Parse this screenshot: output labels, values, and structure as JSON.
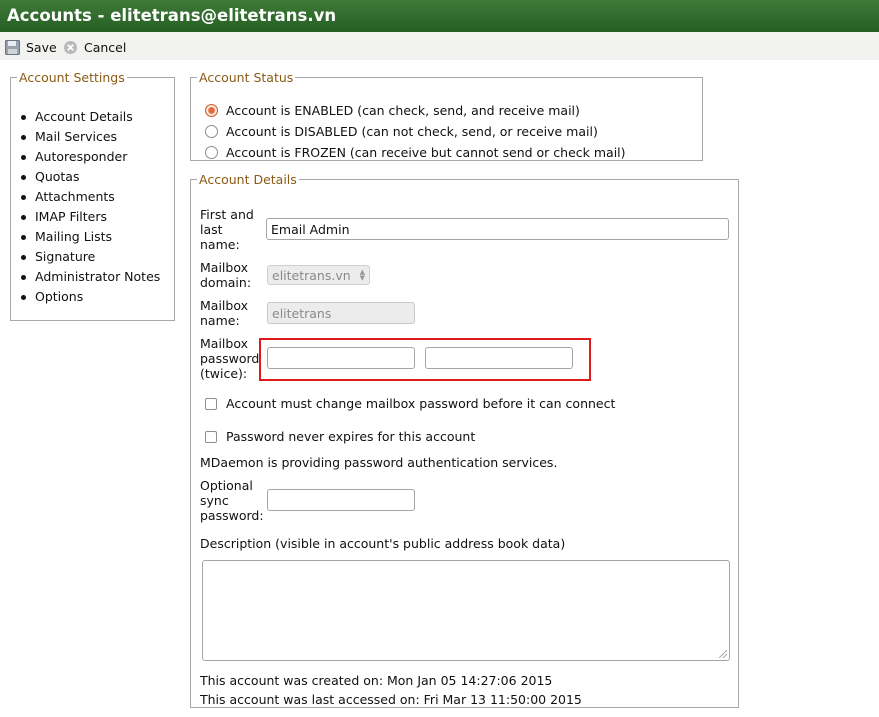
{
  "window": {
    "title": "Accounts - elitetrans@elitetrans.vn"
  },
  "toolbar": {
    "save_label": "Save",
    "cancel_label": "Cancel"
  },
  "sidebar": {
    "legend": "Account Settings",
    "items": [
      {
        "label": "Account Details"
      },
      {
        "label": "Mail Services"
      },
      {
        "label": "Autoresponder"
      },
      {
        "label": "Quotas"
      },
      {
        "label": "Attachments"
      },
      {
        "label": "IMAP Filters"
      },
      {
        "label": "Mailing Lists"
      },
      {
        "label": "Signature"
      },
      {
        "label": "Administrator Notes"
      },
      {
        "label": "Options"
      }
    ]
  },
  "status": {
    "legend": "Account Status",
    "options": [
      {
        "label": "Account is ENABLED (can check, send, and receive mail)",
        "selected": true
      },
      {
        "label": "Account is DISABLED (can not check, send, or receive mail)",
        "selected": false
      },
      {
        "label": "Account is FROZEN (can receive but cannot send or check mail)",
        "selected": false
      }
    ]
  },
  "details": {
    "legend": "Account Details",
    "full_name": {
      "label_lines": [
        "First and",
        "last",
        "name:"
      ],
      "value": "Email Admin"
    },
    "domain": {
      "label_lines": [
        "Mailbox",
        "domain:"
      ],
      "value": "elitetrans.vn"
    },
    "mailbox": {
      "label_lines": [
        "Mailbox",
        "name:"
      ],
      "value": "elitetrans"
    },
    "password": {
      "label_lines": [
        "Mailbox",
        "password",
        "(twice):"
      ],
      "value1": "",
      "value2": ""
    },
    "must_change_label": "Account must change mailbox password before it can connect",
    "never_expires_label": "Password never expires for this account",
    "auth_note": "MDaemon is providing password authentication services.",
    "sync": {
      "label_lines": [
        "Optional",
        "sync",
        "password:"
      ],
      "value": ""
    },
    "description_label": "Description (visible in account's public address book data)",
    "description_value": "",
    "created": "This account was created on: Mon Jan 05 14:27:06 2015",
    "last_accessed": "This account was last accessed on: Fri Mar 13 11:50:00 2015"
  },
  "colors": {
    "titlebar": "#2d6a29",
    "legend": "#8a5a14",
    "highlight": "#e01b1b",
    "radio_selected": "#e8673a"
  }
}
